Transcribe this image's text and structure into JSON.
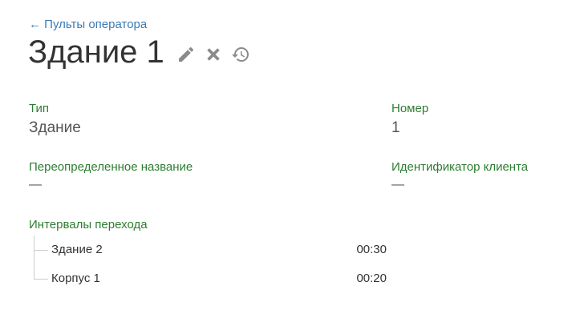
{
  "header": {
    "back_link": "← Пульты оператора",
    "title": "Здание 1",
    "actions": {
      "edit_icon": "pencil-icon",
      "delete_icon": "close-icon",
      "history_icon": "history-icon"
    }
  },
  "fields": {
    "type": {
      "label": "Тип",
      "value": "Здание"
    },
    "number": {
      "label": "Номер",
      "value": "1"
    },
    "override_name": {
      "label": "Переопределенное название",
      "value": "—"
    },
    "client_id": {
      "label": "Идентификатор клиента",
      "value": "—"
    }
  },
  "transitions": {
    "label": "Интервалы перехода",
    "items": [
      {
        "name": "Здание 2",
        "time": "00:30"
      },
      {
        "name": "Корпус 1",
        "time": "00:20"
      }
    ]
  },
  "colors": {
    "link": "#3c7bb5",
    "label_green": "#2e7d32",
    "icon_gray": "#8a8a8a"
  }
}
